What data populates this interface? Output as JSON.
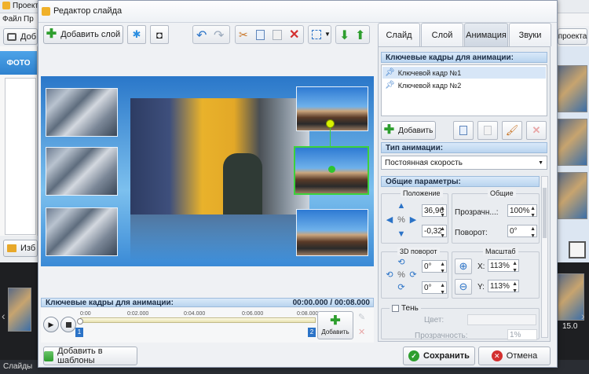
{
  "background_app": {
    "title": "Проект 1",
    "menu": [
      "Файл",
      "Пр"
    ],
    "left_button": "Доб",
    "right_button": "проекта",
    "tab_label": "ФОТО",
    "bottom_left_button": "Изб",
    "status_label": "Слайды",
    "strip_number": "15.0"
  },
  "dialog": {
    "title": "Редактор слайда",
    "toolbar": {
      "add_layer_label": "Добавить слой"
    },
    "tabs": [
      {
        "label": "Слайд",
        "active": false
      },
      {
        "label": "Слой",
        "active": false
      },
      {
        "label": "Анимация",
        "active": true
      },
      {
        "label": "Звуки",
        "active": false
      }
    ],
    "timeline": {
      "header": "Ключевые кадры для анимации:",
      "time_display": "00:00.000 / 00:08.000",
      "ticks": [
        "0:00",
        "0:02.000",
        "0:04.000",
        "0:06.000",
        "0:08.000"
      ],
      "markers": [
        "1",
        "2"
      ],
      "add_label": "Добавить"
    },
    "panel": {
      "keyframes_header": "Ключевые кадры для анимации:",
      "keyframes": [
        {
          "label": "Ключевой кадр №1",
          "selected": true
        },
        {
          "label": "Ключевой кадр №2",
          "selected": false
        }
      ],
      "add_label": "Добавить",
      "anim_type_header": "Тип анимации:",
      "anim_type_value": "Постоянная скорость",
      "general_header": "Общие параметры:",
      "position_title": "Положение",
      "pos_x": "36,96",
      "pos_y": "-0,32",
      "common_title": "Общие",
      "transparency_label": "Прозрачн...:",
      "transparency_value": "100%",
      "rotation_label": "Поворот:",
      "rotation_value": "0°",
      "rot3d_title": "3D поворот",
      "rot3d_a": "0°",
      "rot3d_b": "0°",
      "scale_title": "Масштаб",
      "scale_x_label": "X:",
      "scale_x_value": "113%",
      "scale_y_label": "Y:",
      "scale_y_value": "113%",
      "shadow_label": "Тень",
      "shadow_checked": false,
      "color_label": "Цвет:",
      "shadow_transparency_label": "Прозрачность:",
      "shadow_transparency_value": "1%"
    },
    "footer": {
      "templates_label": "Добавить в шаблоны",
      "save_label": "Сохранить",
      "cancel_label": "Отмена"
    }
  },
  "colors": {
    "accent": "#3b8ad6",
    "save_green": "#2e9e2e",
    "cancel_red": "#d32f2f"
  }
}
